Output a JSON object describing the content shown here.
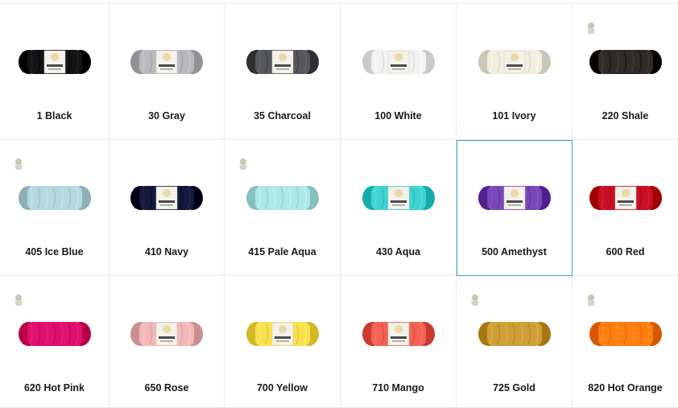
{
  "products": [
    {
      "label": "1 Black",
      "color": "#141414",
      "band": true
    },
    {
      "label": "30 Gray",
      "color": "#b8babd",
      "band": true
    },
    {
      "label": "35 Charcoal",
      "color": "#55575a",
      "band": true
    },
    {
      "label": "100 White",
      "color": "#f2f2f2",
      "band": true
    },
    {
      "label": "101 Ivory",
      "color": "#f2eee0",
      "band": true
    },
    {
      "label": "220 Shale",
      "color": "#2f2b27",
      "band": false
    },
    {
      "label": "405 Ice Blue",
      "color": "#b6d8dc",
      "band": false
    },
    {
      "label": "410 Navy",
      "color": "#14193d",
      "band": true
    },
    {
      "label": "415 Pale Aqua",
      "color": "#aee8e6",
      "band": false
    },
    {
      "label": "430 Aqua",
      "color": "#3fd3d2",
      "band": true
    },
    {
      "label": "500 Amethyst",
      "color": "#7a47b8",
      "band": true
    },
    {
      "label": "600 Red",
      "color": "#c80f26",
      "band": true
    },
    {
      "label": "620 Hot Pink",
      "color": "#e0106e",
      "band": false
    },
    {
      "label": "650 Rose",
      "color": "#f1b8b9",
      "band": true
    },
    {
      "label": "700 Yellow",
      "color": "#fbe04f",
      "band": true
    },
    {
      "label": "710 Mango",
      "color": "#f46357",
      "band": true
    },
    {
      "label": "725 Gold",
      "color": "#cf9f3a",
      "band": false
    },
    {
      "label": "820 Hot Orange",
      "color": "#ff7f12",
      "band": false
    }
  ],
  "selected_index": 10
}
